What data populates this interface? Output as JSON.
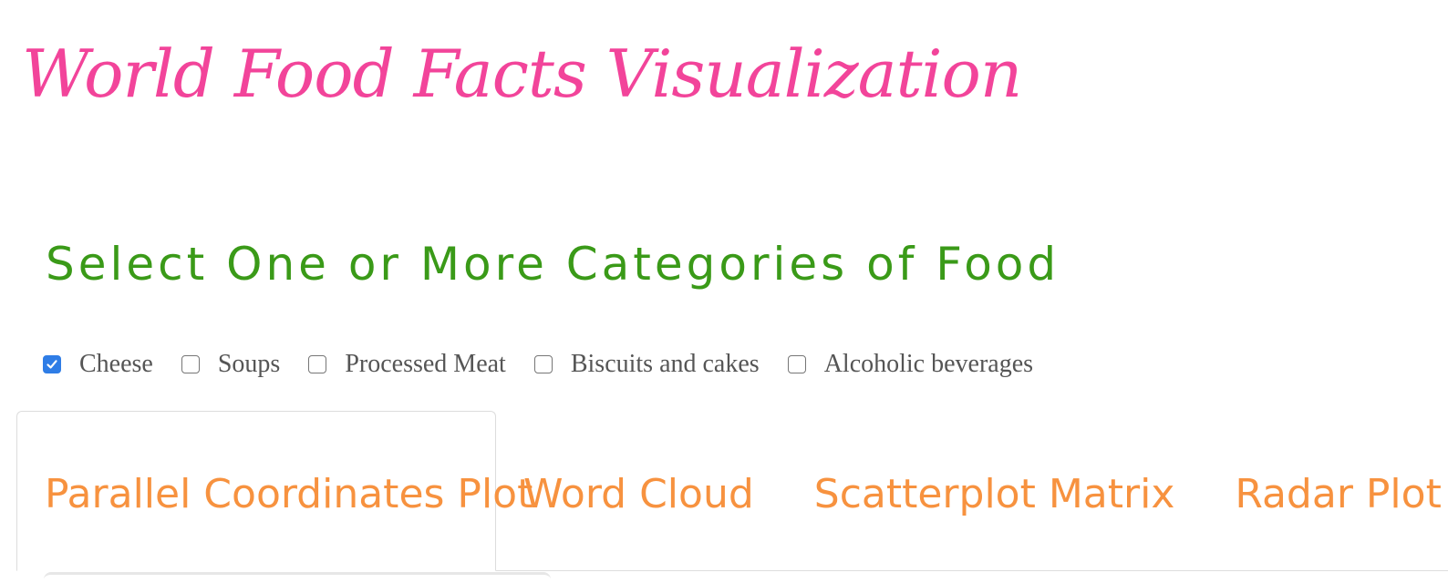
{
  "header": {
    "title": "World Food Facts Visualization"
  },
  "category_selector": {
    "heading": "Select One or More Categories of Food",
    "options": [
      {
        "label": "Cheese",
        "checked": true
      },
      {
        "label": "Soups",
        "checked": false
      },
      {
        "label": "Processed Meat",
        "checked": false
      },
      {
        "label": "Biscuits and cakes",
        "checked": false
      },
      {
        "label": "Alcoholic beverages",
        "checked": false
      }
    ]
  },
  "tabs": [
    {
      "label": "Parallel Coordinates Plot",
      "active": true
    },
    {
      "label": "Word Cloud",
      "active": false
    },
    {
      "label": "Scatterplot Matrix",
      "active": false
    },
    {
      "label": "Radar Plot",
      "active": false
    }
  ],
  "colors": {
    "title": "#f2449a",
    "heading": "#3a9a18",
    "tab_label": "#f7923f",
    "checkbox_accent": "#2f7de6"
  },
  "icons": {
    "checked": "checkmark-icon"
  }
}
